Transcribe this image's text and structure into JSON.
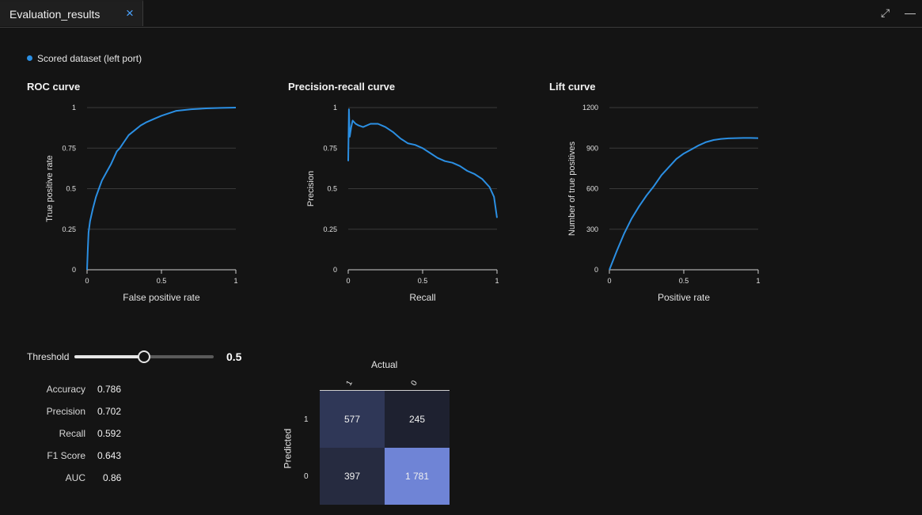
{
  "tab": {
    "title": "Evaluation_results",
    "close_icon": "×"
  },
  "window": {
    "expand_icon": "⤢",
    "minimize_icon": "—"
  },
  "legend": {
    "label": "Scored dataset (left port)",
    "color": "#2b8fe3"
  },
  "colors": {
    "accent": "#2b8fe3",
    "background": "#141414",
    "grid": "#3a3a3a"
  },
  "roc": {
    "title": "ROC curve",
    "xlabel": "False positive rate",
    "ylabel": "True positive rate",
    "chart_data": {
      "type": "line",
      "xlim": [
        0,
        1
      ],
      "ylim": [
        0,
        1
      ],
      "xticks": [
        "0",
        "0.5",
        "1"
      ],
      "yticks": [
        "0",
        "0.25",
        "0.5",
        "0.75",
        "1"
      ],
      "x": [
        0,
        0.005,
        0.01,
        0.02,
        0.04,
        0.06,
        0.08,
        0.1,
        0.13,
        0.16,
        0.2,
        0.22,
        0.25,
        0.28,
        0.32,
        0.36,
        0.4,
        0.45,
        0.5,
        0.55,
        0.6,
        0.7,
        0.8,
        0.9,
        1
      ],
      "y": [
        0,
        0.12,
        0.23,
        0.3,
        0.38,
        0.45,
        0.5,
        0.55,
        0.6,
        0.65,
        0.73,
        0.75,
        0.79,
        0.83,
        0.86,
        0.89,
        0.91,
        0.93,
        0.95,
        0.965,
        0.98,
        0.99,
        0.995,
        0.998,
        1
      ]
    }
  },
  "pr": {
    "title": "Precision-recall curve",
    "xlabel": "Recall",
    "ylabel": "Precision",
    "chart_data": {
      "type": "line",
      "xlim": [
        0,
        1
      ],
      "ylim": [
        0,
        1
      ],
      "xticks": [
        "0",
        "0.5",
        "1"
      ],
      "yticks": [
        "0",
        "0.25",
        "0.5",
        "0.75",
        "1"
      ],
      "x": [
        0,
        0.005,
        0.01,
        0.02,
        0.03,
        0.05,
        0.07,
        0.1,
        0.15,
        0.2,
        0.25,
        0.3,
        0.35,
        0.4,
        0.45,
        0.5,
        0.55,
        0.6,
        0.65,
        0.7,
        0.75,
        0.8,
        0.85,
        0.9,
        0.95,
        0.98,
        1
      ],
      "y": [
        0.67,
        0.99,
        0.82,
        0.88,
        0.92,
        0.9,
        0.89,
        0.88,
        0.9,
        0.9,
        0.88,
        0.85,
        0.81,
        0.78,
        0.77,
        0.75,
        0.72,
        0.69,
        0.67,
        0.66,
        0.64,
        0.61,
        0.59,
        0.56,
        0.51,
        0.45,
        0.32
      ]
    }
  },
  "lift": {
    "title": "Lift curve",
    "xlabel": "Positive rate",
    "ylabel": "Number of true positives",
    "chart_data": {
      "type": "line",
      "xlim": [
        0,
        1
      ],
      "ylim": [
        0,
        1200
      ],
      "xticks": [
        "0",
        "0.5",
        "1"
      ],
      "yticks": [
        "0",
        "300",
        "600",
        "900",
        "1200"
      ],
      "x": [
        0,
        0.05,
        0.1,
        0.15,
        0.2,
        0.25,
        0.3,
        0.35,
        0.4,
        0.45,
        0.5,
        0.55,
        0.6,
        0.65,
        0.7,
        0.75,
        0.8,
        0.85,
        0.9,
        0.95,
        1
      ],
      "y": [
        0,
        140,
        270,
        380,
        470,
        550,
        620,
        700,
        760,
        820,
        860,
        890,
        920,
        945,
        960,
        968,
        972,
        974,
        975,
        975,
        974
      ]
    }
  },
  "threshold": {
    "label": "Threshold",
    "value": "0.5",
    "fraction": 0.5
  },
  "metrics": [
    {
      "name": "Accuracy",
      "value": "0.786"
    },
    {
      "name": "Precision",
      "value": "0.702"
    },
    {
      "name": "Recall",
      "value": "0.592"
    },
    {
      "name": "F1 Score",
      "value": "0.643"
    },
    {
      "name": "AUC",
      "value": "0.86"
    }
  ],
  "confusion_matrix": {
    "actual_label": "Actual",
    "predicted_label": "Predicted",
    "col_labels": [
      "1",
      "0"
    ],
    "row_labels": [
      "1",
      "0"
    ],
    "cells": [
      [
        "577",
        "245"
      ],
      [
        "397",
        "1 781"
      ]
    ],
    "cell_colors": [
      [
        "#2f3757",
        "#1e2130"
      ],
      [
        "#262b40",
        "#6f84d6"
      ]
    ]
  }
}
